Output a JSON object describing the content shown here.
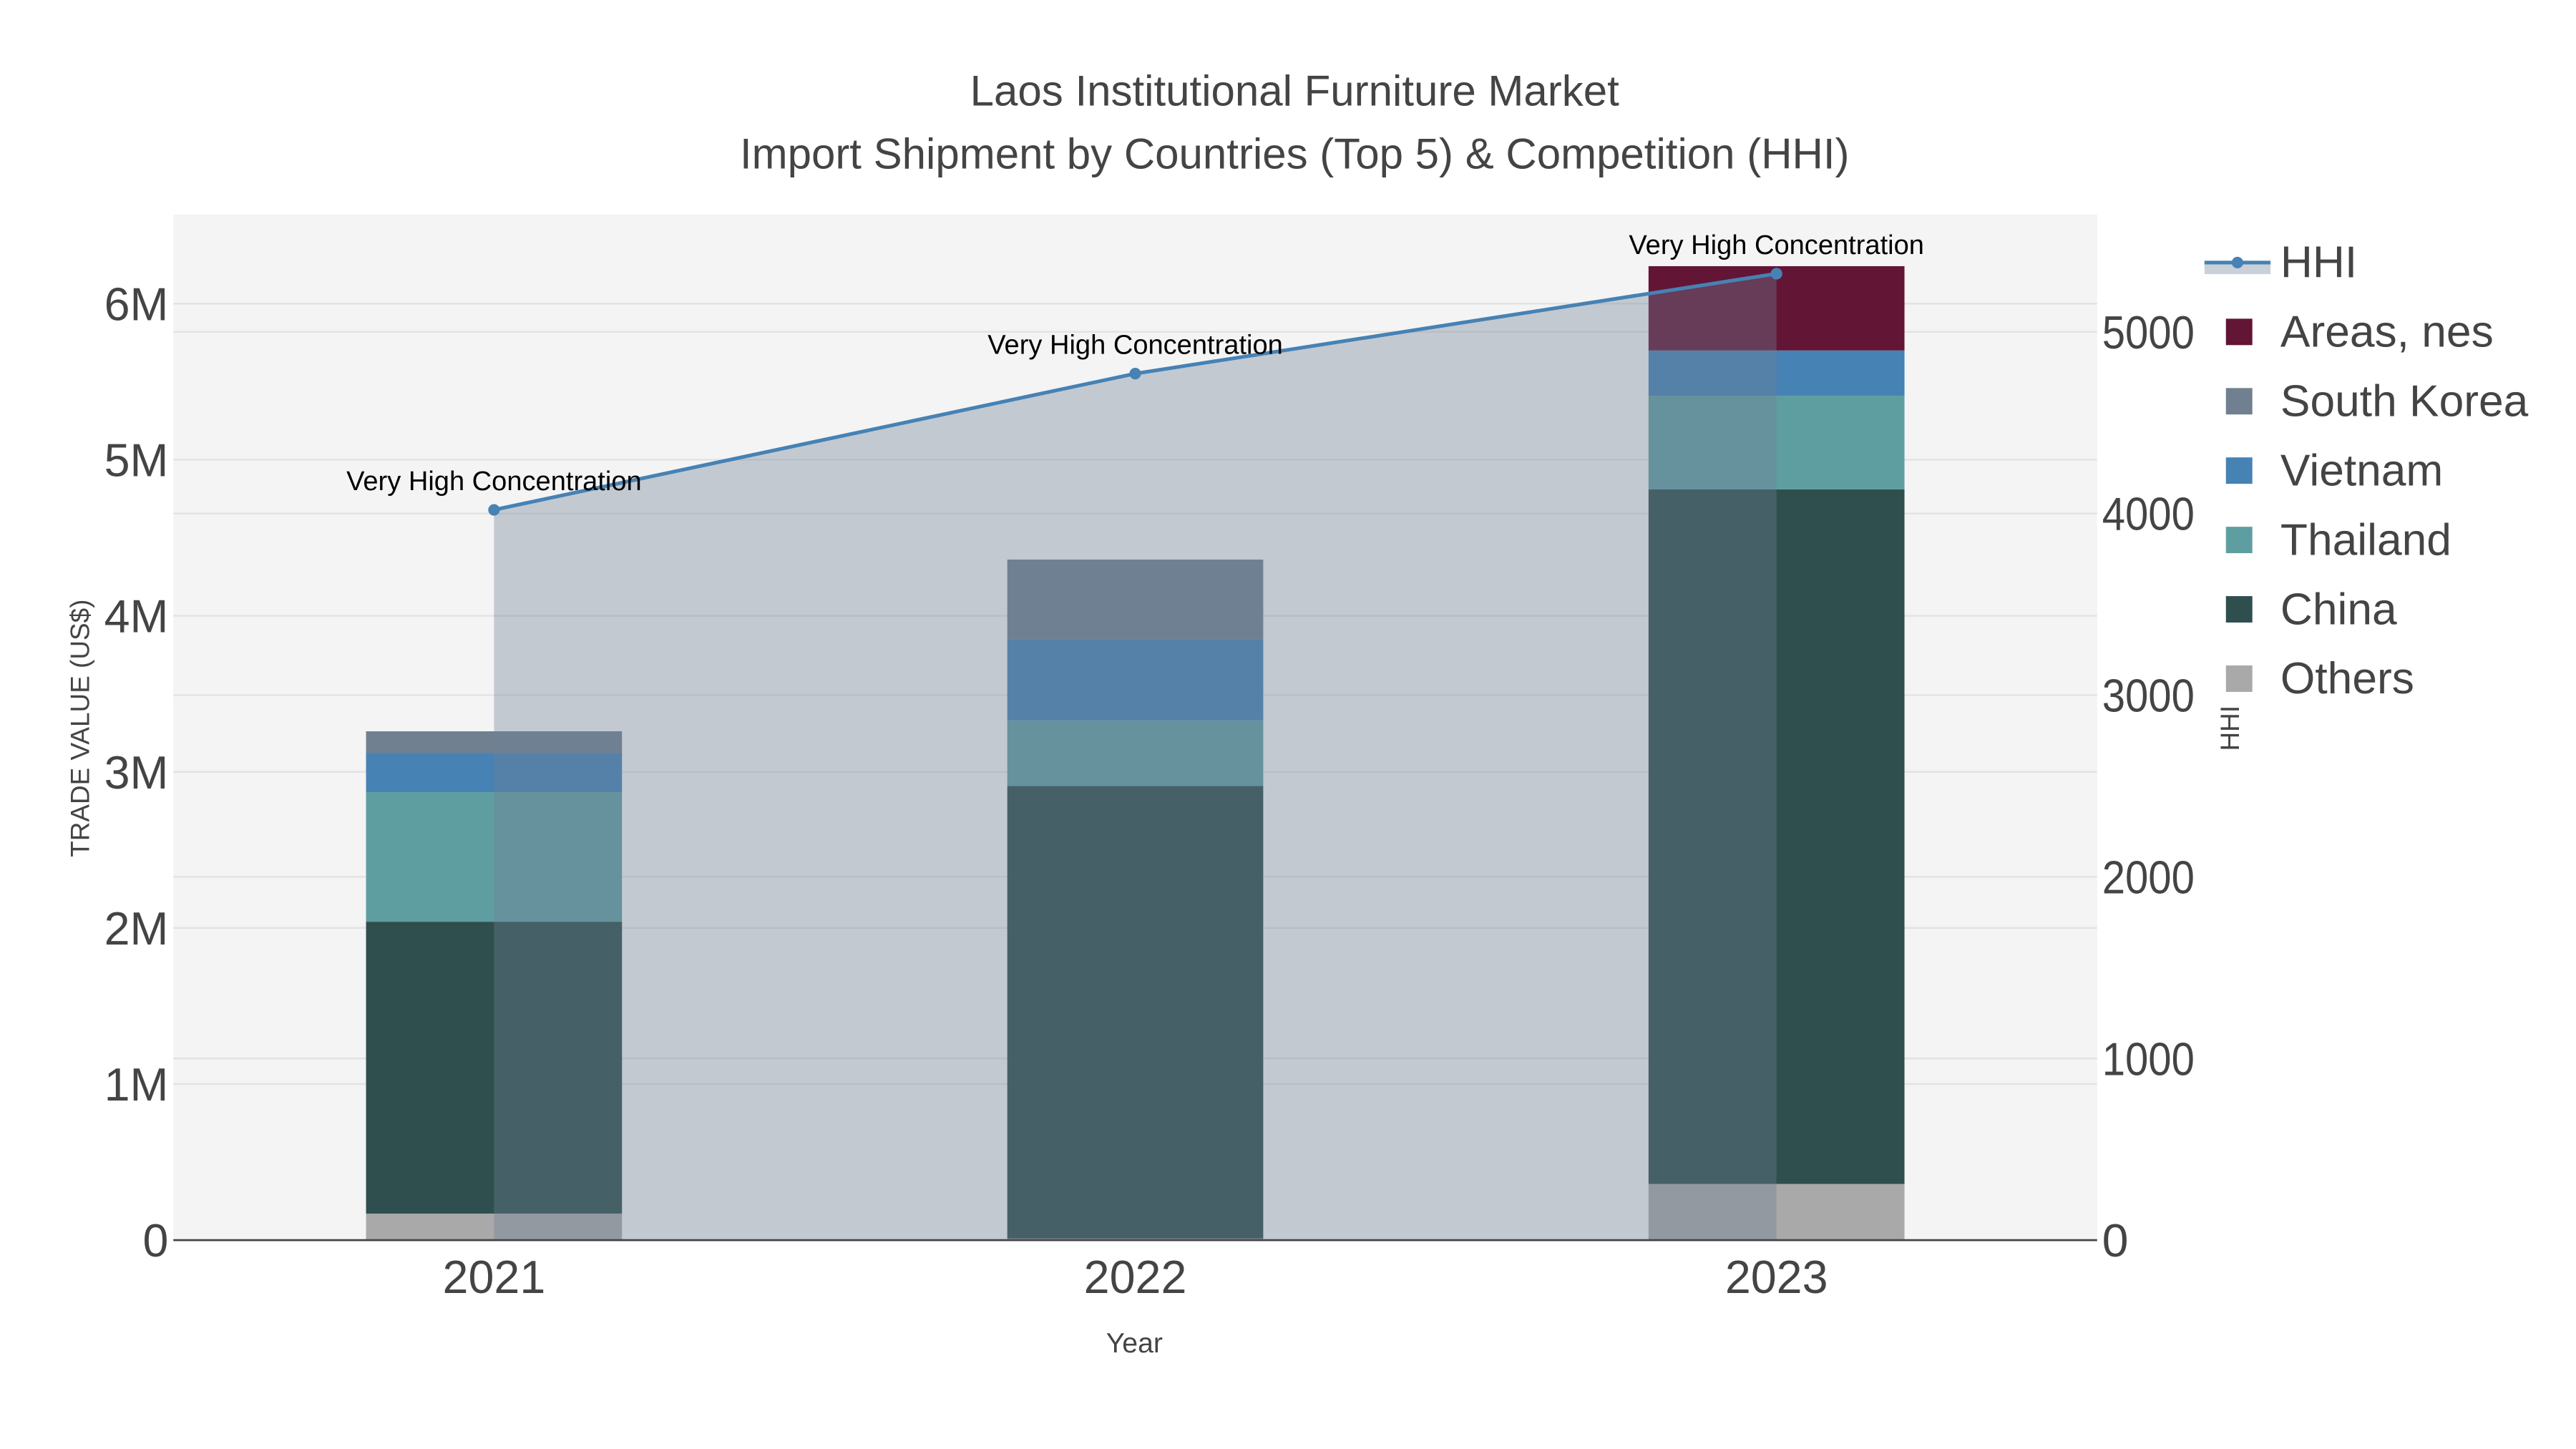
{
  "chart_data": {
    "type": "bar",
    "title": "Laos Institutional Furniture Market",
    "subtitle": "Import Shipment by Countries (Top 5) & Competition (HHI)",
    "xlabel": "Year",
    "ylabel": "TRADE VALUE (US$)",
    "y2label": "HHI",
    "categories": [
      "2021",
      "2022",
      "2023"
    ],
    "ylim": [
      0,
      6570000
    ],
    "y2lim": [
      0,
      5645
    ],
    "yticks": [
      {
        "v": 0,
        "label": "0"
      },
      {
        "v": 1000000,
        "label": "1M"
      },
      {
        "v": 2000000,
        "label": "2M"
      },
      {
        "v": 3000000,
        "label": "3M"
      },
      {
        "v": 4000000,
        "label": "4M"
      },
      {
        "v": 5000000,
        "label": "5M"
      },
      {
        "v": 6000000,
        "label": "6M"
      }
    ],
    "y2ticks": [
      {
        "v": 0,
        "label": "0"
      },
      {
        "v": 1000,
        "label": "1000"
      },
      {
        "v": 2000,
        "label": "2000"
      },
      {
        "v": 3000,
        "label": "3000"
      },
      {
        "v": 4000,
        "label": "4000"
      },
      {
        "v": 5000,
        "label": "5000"
      }
    ],
    "series": [
      {
        "name": "Others",
        "color": "#a9a9a9",
        "values": [
          170000,
          10000,
          360000
        ]
      },
      {
        "name": "China",
        "color": "#2f4f4f",
        "values": [
          1870000,
          2900000,
          4450000
        ]
      },
      {
        "name": "Thailand",
        "color": "#5f9ea0",
        "values": [
          830000,
          420000,
          600000
        ]
      },
      {
        "name": "Vietnam",
        "color": "#4682b4",
        "values": [
          250000,
          520000,
          290000
        ]
      },
      {
        "name": "South Korea",
        "color": "#708090",
        "values": [
          140000,
          510000,
          0
        ]
      },
      {
        "name": "Areas, nes",
        "color": "#631535",
        "values": [
          0,
          0,
          540000
        ]
      }
    ],
    "hhi": {
      "name": "HHI",
      "color": "#4682b4",
      "values": [
        4020,
        4770,
        5320
      ]
    },
    "annotations": [
      "Very High Concentration",
      "Very High Concentration",
      "Very High Concentration"
    ],
    "legend": [
      "HHI",
      "Areas, nes",
      "South Korea",
      "Vietnam",
      "Thailand",
      "China",
      "Others"
    ],
    "legend_position": "top-right",
    "grid": true
  }
}
